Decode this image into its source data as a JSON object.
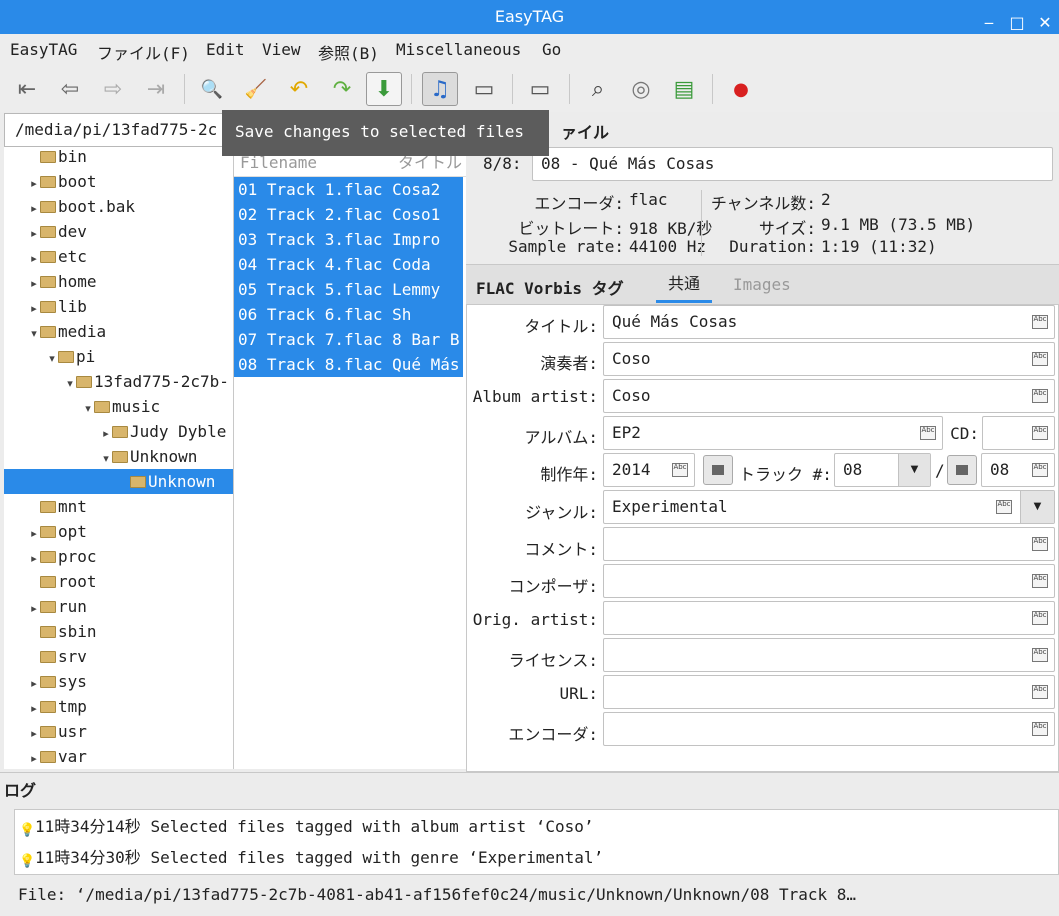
{
  "window": {
    "title": "EasyTAG",
    "minimize": "‒",
    "maximize": "□",
    "close": "✕"
  },
  "menu": [
    "EasyTAG",
    "ファイル(F)",
    "Edit",
    "View",
    "参照(B)",
    "Miscellaneous",
    "Go"
  ],
  "toolbar": {
    "icons": [
      "first-icon",
      "prev-icon",
      "next-icon",
      "last-icon",
      "scan-icon",
      "clear-icon",
      "undo-icon",
      "redo-icon",
      "save-icon",
      "tag-view-icon",
      "image-view-icon",
      "browser-icon",
      "search-icon",
      "cd-icon",
      "playlist-icon",
      "stop-icon"
    ],
    "glyphs": [
      "⇤",
      "⇦",
      "⇨",
      "⇥",
      "🔍",
      "🧹",
      "↶",
      "↷",
      "⬇",
      "♫",
      "▭",
      "▭",
      "⌕",
      "◎",
      "▤",
      "●"
    ],
    "tooltip": "Save changes to selected files"
  },
  "path": "/media/pi/13fad775-2c",
  "tree": [
    {
      "label": "bin",
      "arrow": "",
      "depth": 0
    },
    {
      "label": "boot",
      "arrow": "▸",
      "depth": 0
    },
    {
      "label": "boot.bak",
      "arrow": "▸",
      "depth": 0
    },
    {
      "label": "dev",
      "arrow": "▸",
      "depth": 0
    },
    {
      "label": "etc",
      "arrow": "▸",
      "depth": 0
    },
    {
      "label": "home",
      "arrow": "▸",
      "depth": 0
    },
    {
      "label": "lib",
      "arrow": "▸",
      "depth": 0
    },
    {
      "label": "media",
      "arrow": "▾",
      "depth": 0
    },
    {
      "label": "pi",
      "arrow": "▾",
      "depth": 1
    },
    {
      "label": "13fad775-2c7b-",
      "arrow": "▾",
      "depth": 2
    },
    {
      "label": "music",
      "arrow": "▾",
      "depth": 3
    },
    {
      "label": "Judy Dyble",
      "arrow": "▸",
      "depth": 4
    },
    {
      "label": "Unknown",
      "arrow": "▾",
      "depth": 4
    },
    {
      "label": "Unknown",
      "arrow": "",
      "depth": 5,
      "selected": true
    },
    {
      "label": "mnt",
      "arrow": "",
      "depth": 0
    },
    {
      "label": "opt",
      "arrow": "▸",
      "depth": 0
    },
    {
      "label": "proc",
      "arrow": "▸",
      "depth": 0
    },
    {
      "label": "root",
      "arrow": "",
      "depth": 0
    },
    {
      "label": "run",
      "arrow": "▸",
      "depth": 0
    },
    {
      "label": "sbin",
      "arrow": "",
      "depth": 0
    },
    {
      "label": "srv",
      "arrow": "",
      "depth": 0
    },
    {
      "label": "sys",
      "arrow": "▸",
      "depth": 0
    },
    {
      "label": "tmp",
      "arrow": "▸",
      "depth": 0
    },
    {
      "label": "usr",
      "arrow": "▸",
      "depth": 0
    },
    {
      "label": "var",
      "arrow": "▸",
      "depth": 0
    }
  ],
  "filelist": {
    "col_filename": "Filename",
    "col_title": "タイトル",
    "rows": [
      "01 Track 1.flac Cosa2",
      "02 Track 2.flac Coso1",
      "03 Track 3.flac Impro",
      "04 Track 4.flac Coda",
      "05 Track 5.flac Lemmy",
      "06 Track 6.flac Sh",
      "07 Track 7.flac 8 Bar B",
      "08 Track 8.flac Qué Más"
    ]
  },
  "fileinfo": {
    "header": "ァイル",
    "counter": "8/8:",
    "filename": "08 - Qué Más Cosas",
    "encoder_label": "エンコーダ:",
    "encoder_value": "flac",
    "bitrate_label": "ビットレート:",
    "bitrate_value": "918 KB/秒",
    "samplerate_label": "Sample rate:",
    "samplerate_value": "44100 Hz",
    "channels_label": "チャンネル数:",
    "channels_value": "2",
    "size_label": "サイズ:",
    "size_value": "9.1 MB (73.5 MB)",
    "duration_label": "Duration:",
    "duration_value": "1:19 (11:32)"
  },
  "tabs": {
    "title": "FLAC Vorbis タグ",
    "common": "共通",
    "images": "Images"
  },
  "tags": {
    "title_label": "タイトル:",
    "title": "Qué Más Cosas",
    "artist_label": "演奏者:",
    "artist": "Coso",
    "album_artist_label": "Album artist:",
    "album_artist": "Coso",
    "album_label": "アルバム:",
    "album": "EP2",
    "cd_label": "CD:",
    "cd": "",
    "year_label": "制作年:",
    "year": "2014",
    "track_label": "トラック #:",
    "track": "08",
    "track_sep": "/",
    "track_total": "08",
    "genre_label": "ジャンル:",
    "genre": "Experimental",
    "comment_label": "コメント:",
    "comment": "",
    "composer_label": "コンポーザ:",
    "composer": "",
    "orig_artist_label": "Orig. artist:",
    "orig_artist": "",
    "license_label": "ライセンス:",
    "license": "",
    "url_label": "URL:",
    "url": "",
    "encoded_by_label": "エンコーダ:",
    "encoded_by": "",
    "spell_icon": "Abc"
  },
  "log": {
    "title": "ログ",
    "entries": [
      {
        "time": "11時34分14秒",
        "text": "Selected files tagged with album artist ‘Coso’"
      },
      {
        "time": "11時34分30秒",
        "text": "Selected files tagged with genre ‘Experimental’"
      }
    ]
  },
  "status": "File: ‘/media/pi/13fad775-2c7b-4081-ab41-af156fef0c24/music/Unknown/Unknown/08 Track 8…"
}
